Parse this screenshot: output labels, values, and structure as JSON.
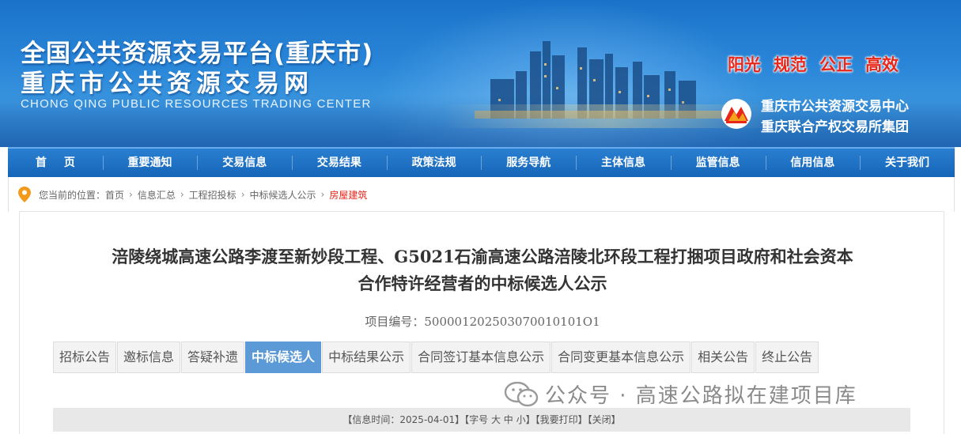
{
  "header": {
    "title_line1": "全国公共资源交易平台(重庆市)",
    "title_line2": "重庆市公共资源交易网",
    "title_en": "CHONG QING PUBLIC RESOURCES TRADING CENTER",
    "slogans": [
      "阳光",
      "规范",
      "公正",
      "高效"
    ],
    "org_line1": "重庆市公共资源交易中心",
    "org_line2": "重庆联合产权交易所集团",
    "colors": {
      "banner": "#2a86d8",
      "slogan": "#e8261a",
      "nav": "#1565b8"
    }
  },
  "nav": {
    "items": [
      "首页",
      "重要通知",
      "交易信息",
      "交易结果",
      "政策法规",
      "服务导航",
      "主体信息",
      "监管信息",
      "信用信息",
      "关于我们"
    ]
  },
  "breadcrumb": {
    "prefix": "您当前的位置：",
    "items": [
      "首页",
      "信息汇总",
      "工程招投标",
      "中标候选人公示",
      "房屋建筑"
    ],
    "separator": "›",
    "icon": "location-pin-icon"
  },
  "article": {
    "title_line1": "涪陵绕城高速公路李渡至新妙段工程、G5021石渝高速公路涪陵北环段工程打捆项目政府和社会资本",
    "title_line2": "合作特许经营者的中标候选人公示",
    "project_no_label": "项目编号：",
    "project_no": "500001202503070010101O1"
  },
  "tabs": {
    "items": [
      "招标公告",
      "邀标信息",
      "答疑补遗",
      "中标候选人",
      "中标结果公示",
      "合同签订基本信息公示",
      "合同变更基本信息公示",
      "相关公告",
      "终止公告"
    ],
    "active_index": 3
  },
  "watermark": {
    "text": "公众号 · 高速公路拟在建项目库",
    "icon": "wechat-icon"
  },
  "infobar": {
    "text": "【信息时间：2025-04-01】【字号 大 中 小】【我要打印】【关闭】"
  }
}
